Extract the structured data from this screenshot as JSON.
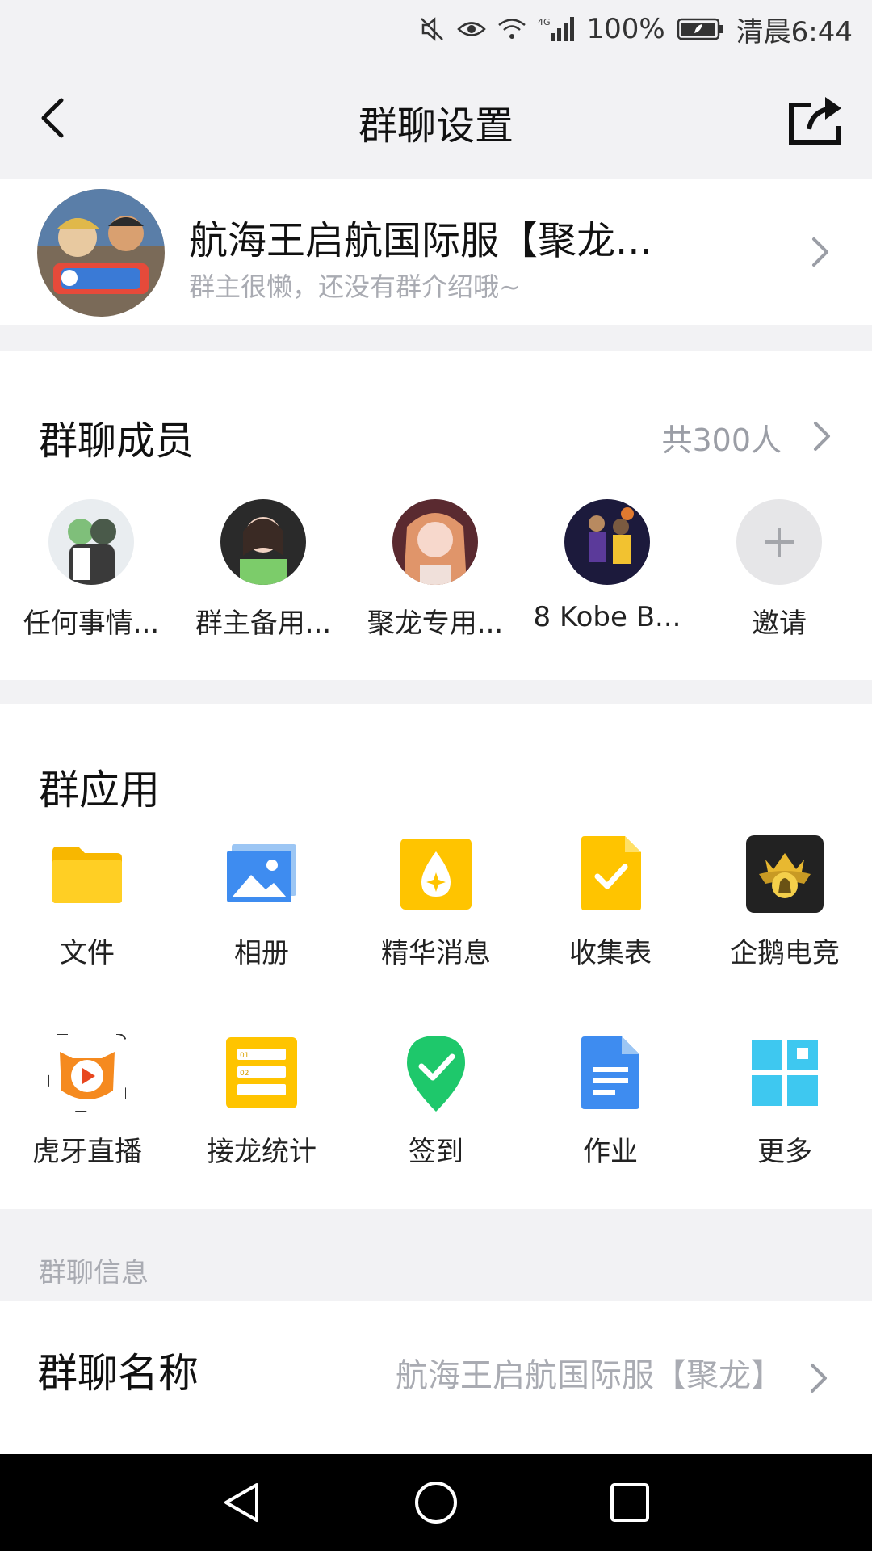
{
  "status_bar": {
    "battery": "100%",
    "time": "清晨6:44",
    "network": "4G"
  },
  "header": {
    "title": "群聊设置"
  },
  "group": {
    "name": "航海王启航国际服【聚龙...",
    "description": "群主很懒，还没有群介绍哦~"
  },
  "members": {
    "title": "群聊成员",
    "count": "共300人",
    "items": [
      {
        "name": "任何事情..."
      },
      {
        "name": "群主备用..."
      },
      {
        "name": "聚龙专用..."
      },
      {
        "name": "8 Kobe B..."
      },
      {
        "name": "邀请"
      }
    ]
  },
  "apps": {
    "title": "群应用",
    "items": [
      {
        "label": "文件",
        "icon": "folder-icon"
      },
      {
        "label": "相册",
        "icon": "album-icon"
      },
      {
        "label": "精华消息",
        "icon": "essence-icon"
      },
      {
        "label": "收集表",
        "icon": "form-icon"
      },
      {
        "label": "企鹅电竞",
        "icon": "esports-icon"
      },
      {
        "label": "虎牙直播",
        "icon": "huya-icon"
      },
      {
        "label": "接龙统计",
        "icon": "solitaire-icon"
      },
      {
        "label": "签到",
        "icon": "checkin-icon"
      },
      {
        "label": "作业",
        "icon": "homework-icon"
      },
      {
        "label": "更多",
        "icon": "more-grid-icon"
      }
    ]
  },
  "info": {
    "section_title": "群聊信息",
    "name_label": "群聊名称",
    "name_value": "航海王启航国际服【聚龙】"
  },
  "colors": {
    "background": "#f2f2f4",
    "secondary_text": "#a9abb2",
    "accent_yellow": "#ffc400",
    "accent_blue": "#3e8cf0",
    "accent_green": "#1ec86b"
  }
}
